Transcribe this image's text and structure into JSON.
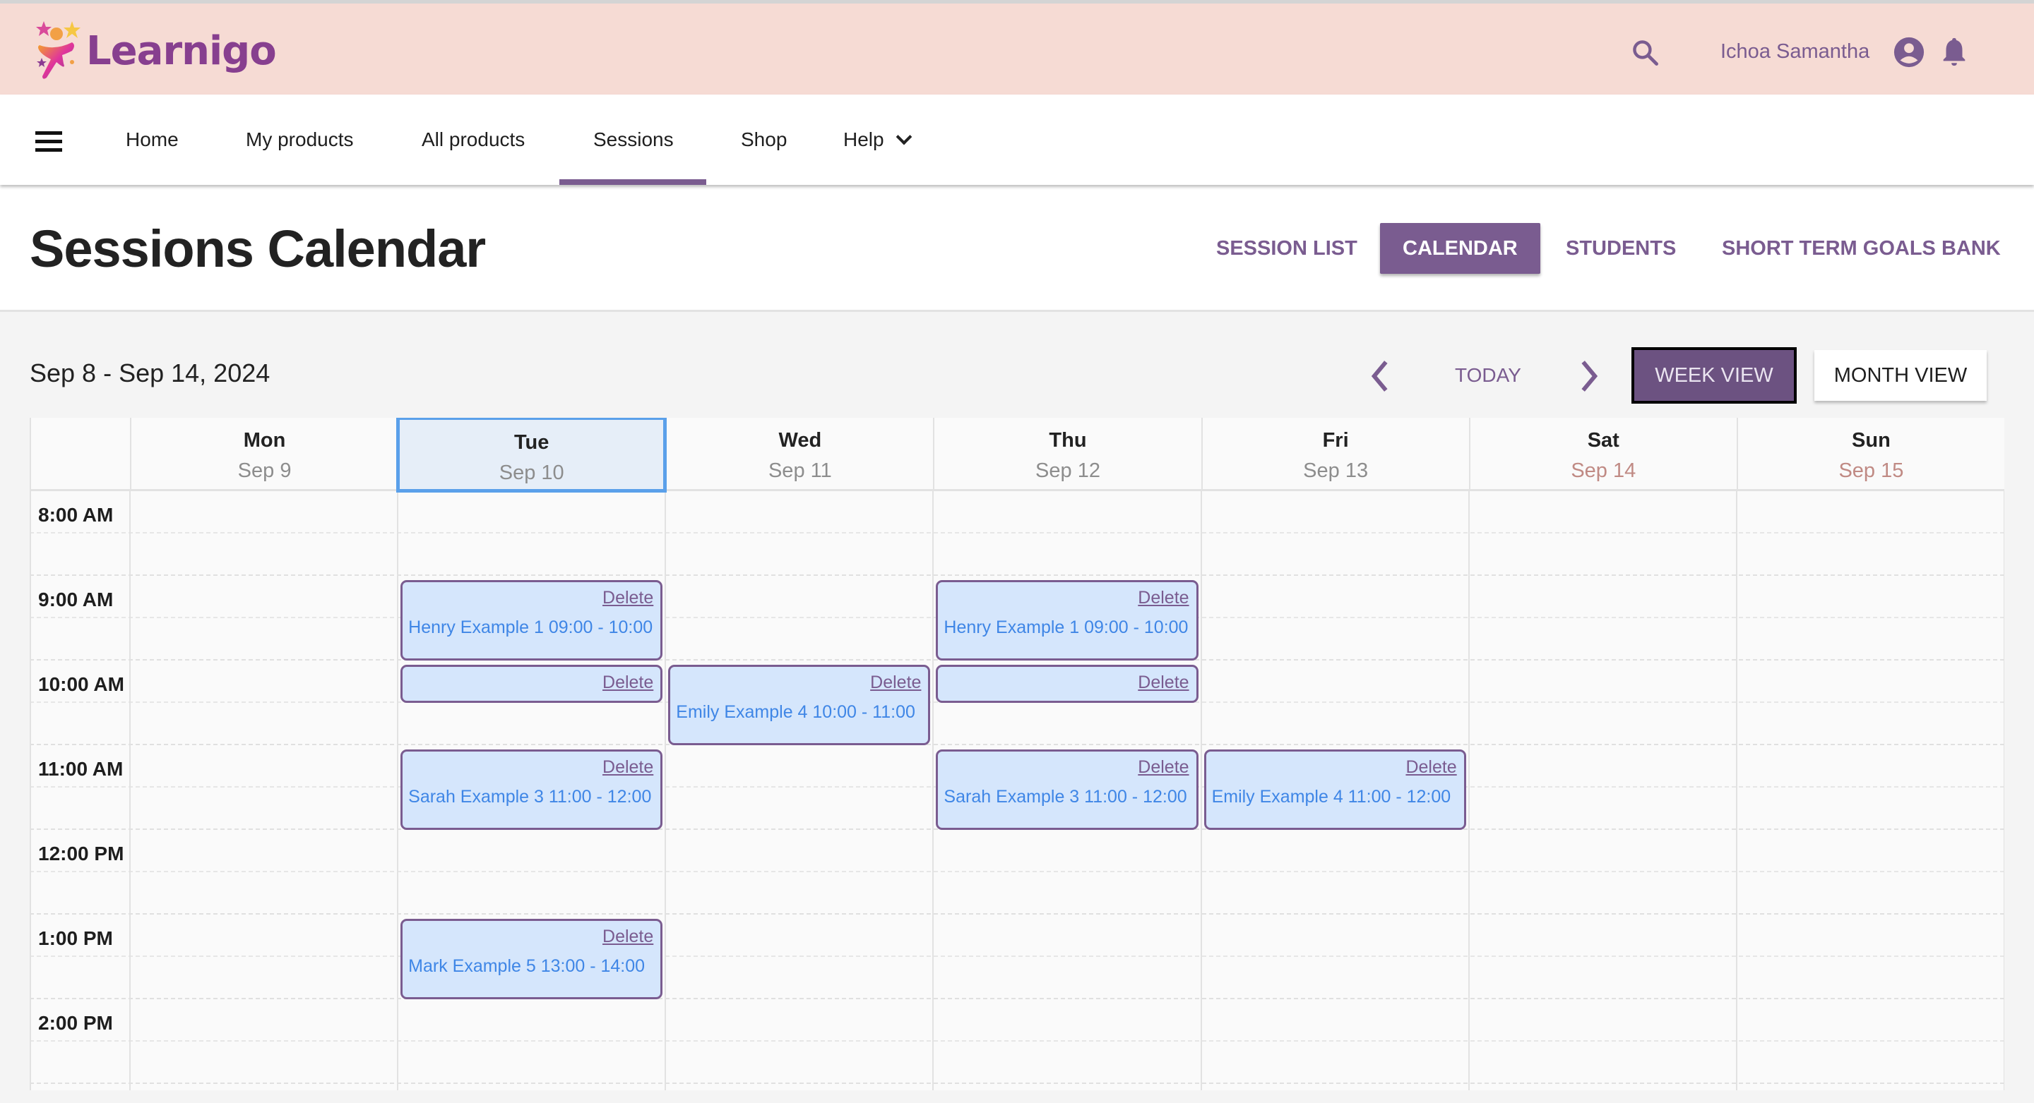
{
  "app": {
    "brand": "Learnigo",
    "user_name": "Ichoa Samantha",
    "colors": {
      "primary": "#7a5c90",
      "header_bg": "#f6dbd4",
      "event_bg": "#d5e6fc",
      "event_text": "#3f86e6",
      "selected_day_border": "#5aa0ea"
    }
  },
  "nav": {
    "items": [
      {
        "label": "Home"
      },
      {
        "label": "My products"
      },
      {
        "label": "All products"
      },
      {
        "label": "Sessions",
        "active": true
      },
      {
        "label": "Shop"
      },
      {
        "label": "Help"
      }
    ]
  },
  "page": {
    "title": "Sessions Calendar",
    "tabs": [
      {
        "label": "SESSION LIST"
      },
      {
        "label": "CALENDAR",
        "active": true
      },
      {
        "label": "STUDENTS"
      },
      {
        "label": "SHORT TERM GOALS BANK"
      }
    ]
  },
  "calendar": {
    "range_label": "Sep 8 - Sep 14, 2024",
    "today_label": "TODAY",
    "week_view_label": "WEEK VIEW",
    "month_view_label": "MONTH VIEW",
    "active_view": "week",
    "selected_day": "Tue",
    "days": [
      {
        "name": "Mon",
        "date": "Sep 9"
      },
      {
        "name": "Tue",
        "date": "Sep 10"
      },
      {
        "name": "Wed",
        "date": "Sep 11"
      },
      {
        "name": "Thu",
        "date": "Sep 12"
      },
      {
        "name": "Fri",
        "date": "Sep 13"
      },
      {
        "name": "Sat",
        "date": "Sep 14"
      },
      {
        "name": "Sun",
        "date": "Sep 15"
      }
    ],
    "hours": [
      "8:00 AM",
      "9:00 AM",
      "10:00 AM",
      "11:00 AM",
      "12:00 PM",
      "1:00 PM",
      "2:00 PM"
    ],
    "delete_label": "Delete",
    "events": [
      {
        "day": 1,
        "start": 9,
        "end": 10,
        "text": "Henry Example 1 09:00 - 10:00"
      },
      {
        "day": 1,
        "start": 10,
        "end": 10.5,
        "text": ""
      },
      {
        "day": 1,
        "start": 11,
        "end": 12,
        "text": "Sarah Example 3 11:00 - 12:00"
      },
      {
        "day": 1,
        "start": 13,
        "end": 14,
        "text": "Mark Example 5 13:00 - 14:00"
      },
      {
        "day": 2,
        "start": 10,
        "end": 11,
        "text": "Emily Example 4 10:00 - 11:00"
      },
      {
        "day": 3,
        "start": 9,
        "end": 10,
        "text": "Henry Example 1 09:00 - 10:00"
      },
      {
        "day": 3,
        "start": 10,
        "end": 10.5,
        "text": ""
      },
      {
        "day": 3,
        "start": 11,
        "end": 12,
        "text": "Sarah Example 3 11:00 - 12:00"
      },
      {
        "day": 4,
        "start": 11,
        "end": 12,
        "text": "Emily Example 4 11:00 - 12:00"
      }
    ]
  }
}
